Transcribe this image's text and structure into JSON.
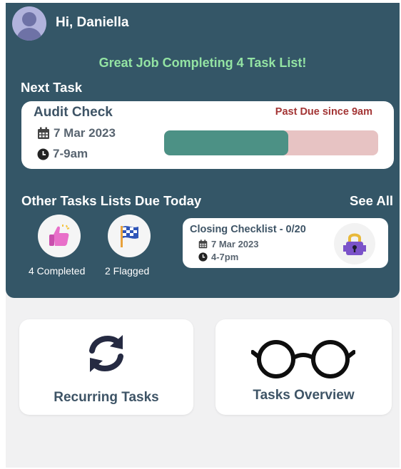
{
  "user": {
    "greeting": "Hi, Daniella"
  },
  "banner": {
    "message": "Great Job Completing 4 Task List!"
  },
  "next_task": {
    "section_title": "Next Task",
    "name": "Audit Check",
    "status": "Past Due since 9am",
    "date": "7 Mar 2023",
    "time": "7-9am",
    "progress": 0.58
  },
  "other_tasks": {
    "section_title": "Other Tasks Lists Due Today",
    "see_all_label": "See All",
    "completed_label": "4 Completed",
    "flagged_label": "2 Flagged",
    "checklist": {
      "title": "Closing Checklist - 0/20",
      "date": "7 Mar 2023",
      "time": "4-7pm"
    }
  },
  "tiles": {
    "recurring_label": "Recurring Tasks",
    "overview_label": "Tasks Overview"
  },
  "icons": {
    "avatar": "person-avatar-icon",
    "calendar": "calendar-icon",
    "clock": "clock-icon",
    "thumbs_up": "thumbs-up-icon",
    "flag": "checkered-flag-icon",
    "lock": "padlock-icon",
    "recurring": "refresh-arrows-icon",
    "overview": "glasses-icon"
  },
  "colors": {
    "header_bg": "#345667",
    "congrats": "#93e3a3",
    "past_due": "#a33535",
    "progress_fill": "#4c9185",
    "progress_track": "#e7c3c3",
    "dark_text": "#3e5466"
  }
}
